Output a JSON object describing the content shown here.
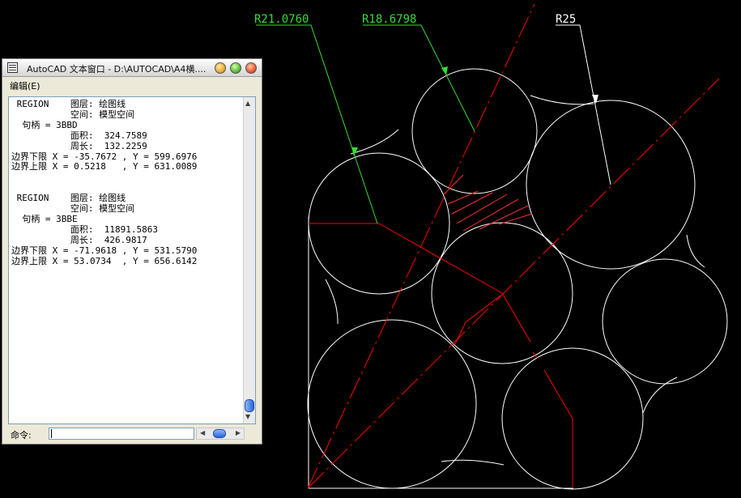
{
  "drawing": {
    "dimensions": {
      "r1": "R21.0760",
      "r2": "R18.6798",
      "r3": "R25"
    },
    "colors": {
      "background": "#000000",
      "geometry": "#ffffff",
      "centerlines": "#ff0000",
      "dim_green": "#33dd33",
      "dim_white": "#ffffff"
    }
  },
  "text_window": {
    "title": "AutoCAD 文本窗口 - D:\\AUTOCAD\\A4横....",
    "menu": {
      "edit": "编辑(E)"
    },
    "log_lines": [
      " REGION    图层: 绘图线",
      "           空间: 模型空间",
      "  句柄 = 3BBD",
      "           面积:  324.7589",
      "           周长:  132.2259",
      "边界下限 X = -35.7672 , Y = 599.6976",
      "边界上限 X = 0.5218   , Y = 631.0089",
      "",
      "",
      " REGION    图层: 绘图线",
      "           空间: 模型空间",
      "  句柄 = 3BBE",
      "           面积:  11891.5863",
      "           周长:  426.9817",
      "边界下限 X = -71.9618 , Y = 531.5790",
      "边界上限 X = 53.0734  , Y = 656.6142"
    ],
    "command_label": "命令:",
    "command_value": ""
  }
}
